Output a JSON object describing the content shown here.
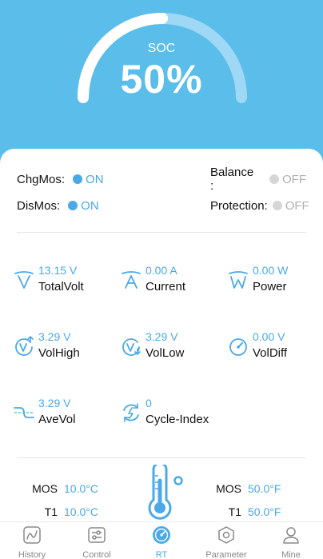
{
  "gauge": {
    "label": "SOC",
    "value": "50%",
    "percent": 50
  },
  "status": {
    "chg_mos": {
      "label": "ChgMos:",
      "state": "ON"
    },
    "dis_mos": {
      "label": "DisMos:",
      "state": "ON"
    },
    "balance": {
      "label": "Balance :",
      "state": "OFF"
    },
    "protection": {
      "label": "Protection:",
      "state": "OFF"
    }
  },
  "metrics": {
    "total_volt": {
      "value": "13.15 V",
      "name": "TotalVolt",
      "icon": "volt-icon"
    },
    "current": {
      "value": "0.00 A",
      "name": "Current",
      "icon": "ampere-icon"
    },
    "power": {
      "value": "0.00 W",
      "name": "Power",
      "icon": "watt-icon"
    },
    "vol_high": {
      "value": "3.29 V",
      "name": "VolHigh",
      "icon": "volt-up-icon"
    },
    "vol_low": {
      "value": "3.29 V",
      "name": "VolLow",
      "icon": "volt-down-icon"
    },
    "vol_diff": {
      "value": "0.00 V",
      "name": "VolDiff",
      "icon": "gauge-icon"
    },
    "ave_vol": {
      "value": "3.29 V",
      "name": "AveVol",
      "icon": "wave-icon"
    },
    "cycle_index": {
      "value": "0",
      "name": "Cycle-Index",
      "icon": "cycle-icon"
    }
  },
  "temperatures": {
    "celsius": [
      {
        "label": "MOS",
        "value": "10.0°C"
      },
      {
        "label": "T1",
        "value": "10.0°C"
      }
    ],
    "fahrenheit": [
      {
        "label": "MOS",
        "value": "50.0°F"
      },
      {
        "label": "T1",
        "value": "50.0°F"
      }
    ]
  },
  "tabs": [
    {
      "label": "History",
      "icon": "chart-icon",
      "active": false
    },
    {
      "label": "Control",
      "icon": "sliders-icon",
      "active": false
    },
    {
      "label": "RT",
      "icon": "dashboard-icon",
      "active": true
    },
    {
      "label": "Parameter",
      "icon": "hexagon-gear-icon",
      "active": false
    },
    {
      "label": "Mine",
      "icon": "user-icon",
      "active": false
    }
  ],
  "colors": {
    "header_bg": "#5bbdea",
    "accent": "#4ba9e8",
    "off_dot": "#d6d6d6"
  }
}
